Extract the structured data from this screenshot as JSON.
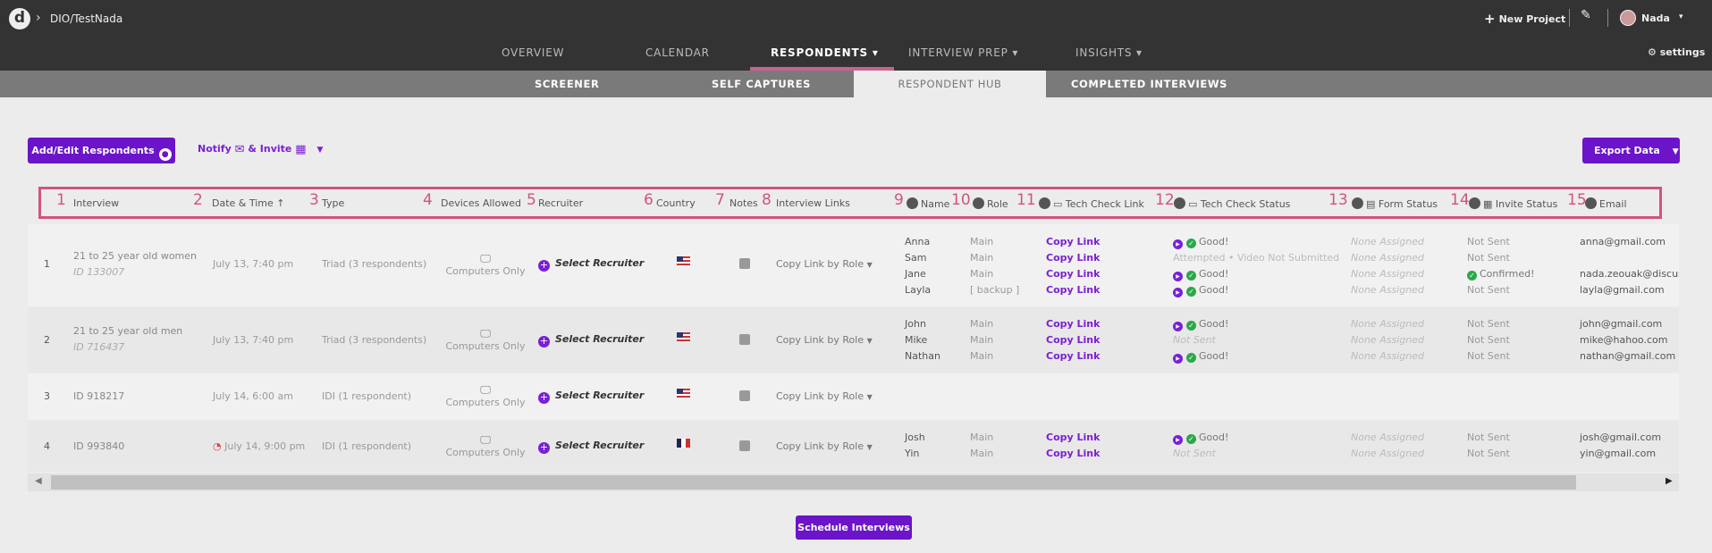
{
  "app": {
    "logo": "d",
    "breadcrumb": "DIO/TestNada",
    "new_project": "New Project",
    "user": "Nada",
    "settings": "settings"
  },
  "main_nav": [
    {
      "label": "OVERVIEW"
    },
    {
      "label": "CALENDAR"
    },
    {
      "label": "RESPONDENTS ▾"
    },
    {
      "label": "INTERVIEW PREP ▾"
    },
    {
      "label": "INSIGHTS ▾"
    }
  ],
  "sub_nav": [
    {
      "label": "SCREENER"
    },
    {
      "label": "SELF CAPTURES"
    },
    {
      "label": "RESPONDENT HUB"
    },
    {
      "label": "COMPLETED INTERVIEWS"
    }
  ],
  "toolbar": {
    "add_edit": "Add/Edit Respondents",
    "notify": "Notify",
    "invite": "& Invite",
    "export": "Export Data"
  },
  "headers": [
    {
      "num": "1",
      "label": "Interview"
    },
    {
      "num": "2",
      "label": "Date & Time ↑"
    },
    {
      "num": "3",
      "label": "Type"
    },
    {
      "num": "4",
      "label": "Devices Allowed"
    },
    {
      "num": "5",
      "label": "Recruiter"
    },
    {
      "num": "6",
      "label": "Country"
    },
    {
      "num": "7",
      "label": "Notes"
    },
    {
      "num": "8",
      "label": "Interview Links"
    },
    {
      "num": "9",
      "label": "Name"
    },
    {
      "num": "10",
      "label": "Role"
    },
    {
      "num": "11",
      "label": "Tech Check Link"
    },
    {
      "num": "12",
      "label": "Tech Check Status"
    },
    {
      "num": "13",
      "label": "Form Status"
    },
    {
      "num": "14",
      "label": "Invite Status"
    },
    {
      "num": "15",
      "label": "Email"
    }
  ],
  "common": {
    "select_recruiter": "Select Recruiter",
    "computers_only": "Computers Only",
    "copy_by_role": "Copy Link by Role",
    "copy_link": "Copy Link",
    "none_assigned": "None Assigned",
    "not_sent": "Not Sent",
    "good": "Good!",
    "schedule": "Schedule Interviews"
  },
  "rows": [
    {
      "index": "1",
      "title": "21 to 25 year old women",
      "id": "ID 133007",
      "date": "July 13, 7:40 pm",
      "type": "Triad (3 respondents)",
      "people": [
        {
          "name": "Anna",
          "role": "Main",
          "tech": "Good!",
          "invite": "Not Sent",
          "email": "anna@gmail.com"
        },
        {
          "name": "Sam",
          "role": "Main",
          "tech": "Attempted • Video Not Submitted",
          "invite": "Not Sent",
          "email": ""
        },
        {
          "name": "Jane",
          "role": "Main",
          "tech": "Good!",
          "invite": "Confirmed!",
          "email": "nada.zeouak@discus"
        },
        {
          "name": "Layla",
          "role": "[ backup ]",
          "tech": "Good!",
          "invite": "Not Sent",
          "email": "layla@gmail.com"
        }
      ]
    },
    {
      "index": "2",
      "title": "21 to 25 year old men",
      "id": "ID 716437",
      "date": "July 13, 7:40 pm",
      "type": "Triad (3 respondents)",
      "people": [
        {
          "name": "John",
          "role": "Main",
          "tech": "Good!",
          "invite": "Not Sent",
          "email": "john@gmail.com"
        },
        {
          "name": "Mike",
          "role": "Main",
          "tech": "Not Sent",
          "invite": "Not Sent",
          "email": "mike@hahoo.com"
        },
        {
          "name": "Nathan",
          "role": "Main",
          "tech": "Good!",
          "invite": "Not Sent",
          "email": "nathan@gmail.com"
        }
      ]
    },
    {
      "index": "3",
      "title": "ID 918217",
      "date": "July 14, 6:00 am",
      "type": "IDI (1 respondent)"
    },
    {
      "index": "4",
      "title": "ID 993840",
      "date": "July 14, 9:00 pm",
      "type": "IDI (1 respondent)",
      "people": [
        {
          "name": "Josh",
          "role": "Main",
          "tech": "Good!",
          "invite": "Not Sent",
          "email": "josh@gmail.com"
        },
        {
          "name": "Yin",
          "role": "Main",
          "tech": "Not Sent",
          "invite": "Not Sent",
          "email": "yin@gmail.com"
        }
      ]
    }
  ]
}
